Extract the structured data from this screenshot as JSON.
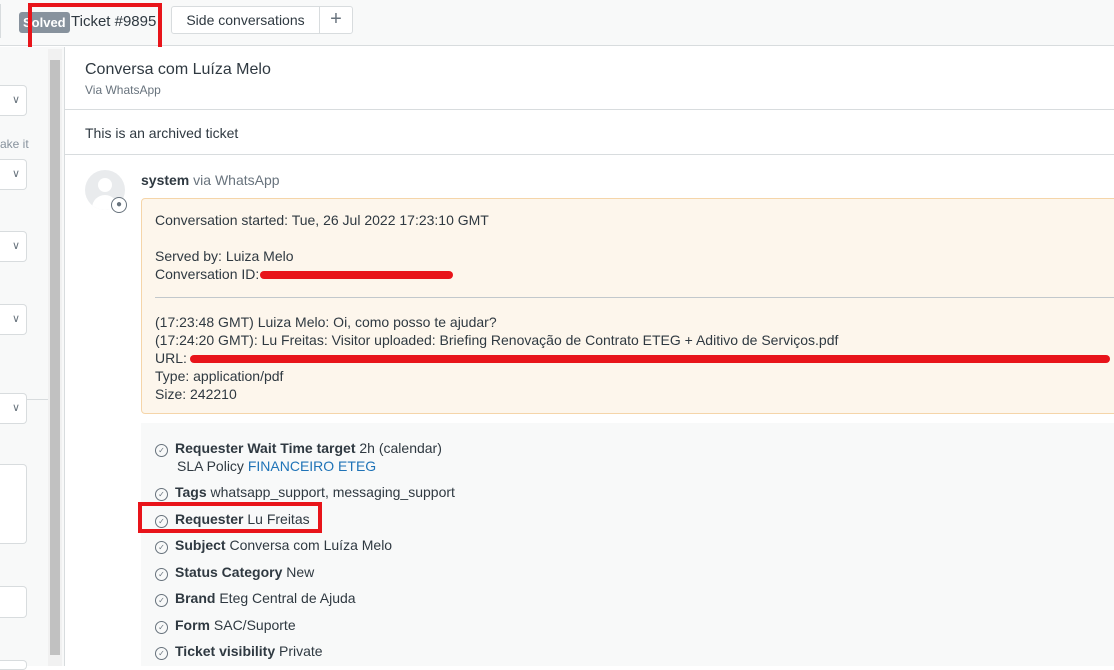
{
  "tabs": {
    "ticket_status": "Solved",
    "ticket_title": "Ticket #9895",
    "side_conversations": "Side conversations",
    "add_label": "+"
  },
  "sidebar": {
    "partial_text": "ake it"
  },
  "conversation": {
    "title": "Conversa com Luíza Melo",
    "via": "Via WhatsApp",
    "archived_notice": "This is an archived ticket"
  },
  "message": {
    "author": "system",
    "via": "via WhatsApp",
    "line_started": "Conversation started: Tue, 26 Jul 2022 17:23:10 GMT",
    "line_served": "Served by: Luiza Melo",
    "line_conv_id": "Conversation ID:",
    "line_greeting": "(17:23:48 GMT) Luiza Melo: Oi, como posso te ajudar?",
    "line_upload": "(17:24:20 GMT): Lu Freitas: Visitor uploaded: Briefing Renovação de Contrato ETEG + Aditivo de Serviços.pdf",
    "line_url": "URL:",
    "line_type": "Type: application/pdf",
    "line_size": "Size: 242210"
  },
  "events": [
    {
      "label": "Requester Wait Time target",
      "value": "2h (calendar)",
      "sub_prefix": "SLA Policy",
      "sub_link": "FINANCEIRO ETEG"
    },
    {
      "label": "Tags",
      "value": "whatsapp_support, messaging_support"
    },
    {
      "label": "Requester",
      "value": "Lu Freitas"
    },
    {
      "label": "Subject",
      "value": "Conversa com Luíza Melo"
    },
    {
      "label": "Status Category",
      "value": "New"
    },
    {
      "label": "Brand",
      "value": "Eteg Central de Ajuda"
    },
    {
      "label": "Form",
      "value": "SAC/Suporte"
    },
    {
      "label": "Ticket visibility",
      "value": "Private"
    }
  ],
  "colors": {
    "highlight": "#e8141a",
    "link": "#1f73b7",
    "message_bg": "#fdf6ec"
  }
}
